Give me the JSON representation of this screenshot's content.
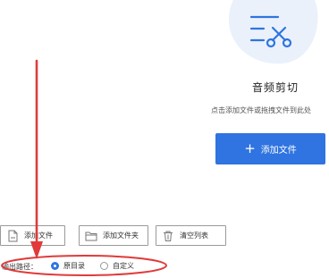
{
  "tool": {
    "icon": "scissors-list-icon",
    "title": "音频剪切",
    "drop_hint": "点击添加文件或拖拽文件到此处"
  },
  "add_file_button": {
    "icon": "plus-icon",
    "label": "添加文件"
  },
  "toolbar": {
    "add_file": "添加文件",
    "add_folder": "添加文件夹",
    "clear_list": "清空列表"
  },
  "output_path": {
    "label": "输出路径：",
    "options": [
      {
        "label": "原目录",
        "selected": true
      },
      {
        "label": "自定义",
        "selected": false
      }
    ]
  },
  "colors": {
    "accent": "#2f74e0",
    "annotation": "#e03a3a",
    "icon_bg": "#eaf1fb"
  }
}
